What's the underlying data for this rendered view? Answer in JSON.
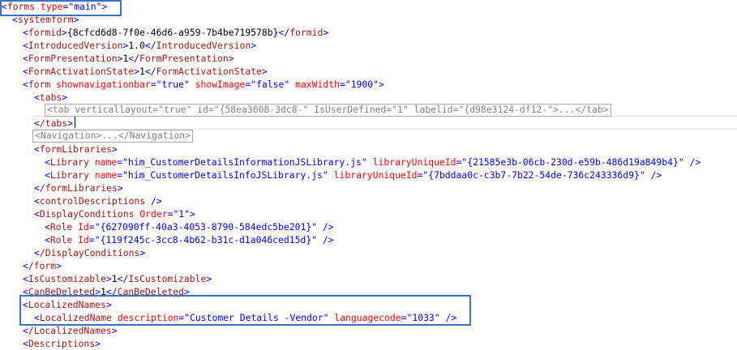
{
  "xml": {
    "forms_tag": "forms",
    "forms_type_attr": "type",
    "forms_type_value": "main",
    "systemform_tag": "systemform",
    "formid_tag": "formid",
    "formid_value": "{8cfcd6d8-7f0e-46d6-a959-7b4be719578b}",
    "introduced_version_tag": "IntroducedVersion",
    "introduced_version_value": "1.0",
    "form_presentation_tag": "FormPresentation",
    "form_presentation_value": "1",
    "form_activation_state_tag": "FormActivationState",
    "form_activation_state_value": "1",
    "form_tag": "form",
    "form_attrs": [
      {
        "name": "shownavigationbar",
        "value": "true"
      },
      {
        "name": "showImage",
        "value": "false"
      },
      {
        "name": "maxWidth",
        "value": "1900"
      }
    ],
    "tabs_tag": "tabs",
    "collapsed_tab_text": "<tab verticallayout=\"true\" id=\"{58ea3608-3dc8-\" IsUserDefined=\"1\" labelid=\"{d98e3124-df12-\">...</tab>",
    "tabs_close_tag": "/tabs",
    "collapsed_navigation_text": "<Navigation>...</Navigation>",
    "form_libraries_tag": "formLibraries",
    "libraries": [
      {
        "tag": "Library",
        "name_attr": "name",
        "name": "him_CustomerDetailsInformationJSLibrary.js",
        "id_attr": "libraryUniqueId",
        "id": "{21585e3b-06cb-230d-e59b-486d19a849b4}"
      },
      {
        "tag": "Library",
        "name_attr": "name",
        "name": "him_CustomerDetailsInfoJSLibrary.js",
        "id_attr": "libraryUniqueId",
        "id": "{7bddaa0c-c3b7-7b22-54de-736c243336d9}"
      }
    ],
    "form_libraries_close_tag": "/formLibraries",
    "control_descriptions_tag": "controlDescriptions",
    "display_conditions_tag": "DisplayConditions",
    "display_conditions_attr": "Order",
    "display_conditions_order": "1",
    "roles": [
      {
        "tag": "Role",
        "attr": "Id",
        "id": "{627090ff-40a3-4053-8790-584edc5be201}"
      },
      {
        "tag": "Role",
        "attr": "Id",
        "id": "{119f245c-3cc8-4b62-b31c-d1a046ced15d}"
      }
    ],
    "display_conditions_close_tag": "/DisplayConditions",
    "form_close_tag": "/form",
    "is_customizable_tag": "IsCustomizable",
    "is_customizable_value": "1",
    "can_be_deleted_tag": "CanBeDeleted",
    "can_be_deleted_value": "1",
    "localized_names_tag": "LocalizedNames",
    "localized_name_tag": "LocalizedName",
    "localized_name_desc_attr": "description",
    "localized_name_description": "Customer Details -Vendor",
    "localized_name_lang_attr": "languagecode",
    "localized_name_languagecode": "1033",
    "localized_names_close_tag": "/LocalizedNames",
    "descriptions_tag": "Descriptions"
  },
  "colors": {
    "tag": "#a31515",
    "punctuation": "#0000ff",
    "attribute": "#ff0000",
    "value": "#0000ff",
    "highlight_border": "#3a72c8"
  }
}
